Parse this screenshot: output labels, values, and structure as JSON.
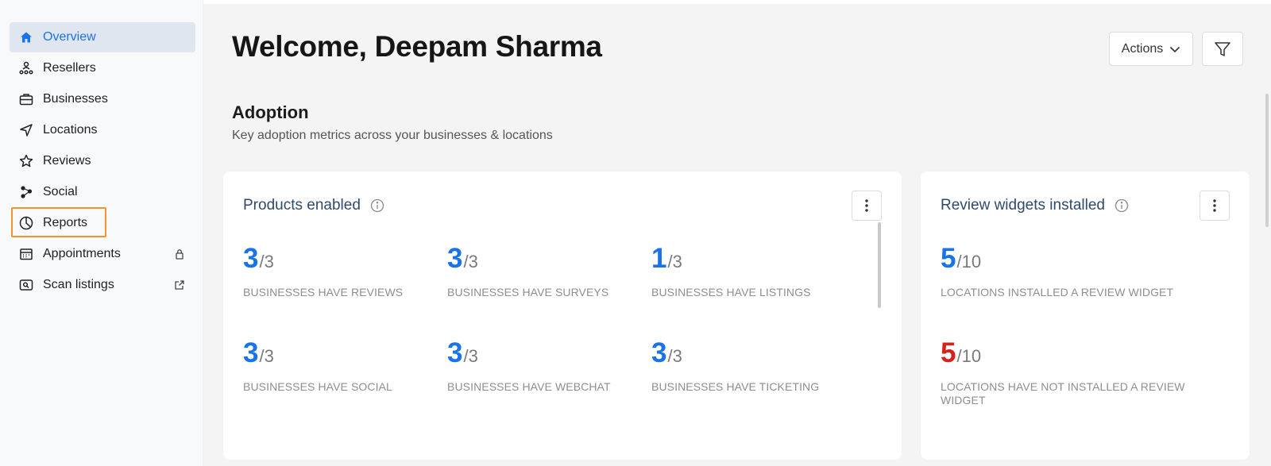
{
  "sidebar": {
    "items": [
      {
        "label": "Overview",
        "icon": "home-icon"
      },
      {
        "label": "Resellers",
        "icon": "resellers-icon"
      },
      {
        "label": "Businesses",
        "icon": "briefcase-icon"
      },
      {
        "label": "Locations",
        "icon": "navigation-arrow-icon"
      },
      {
        "label": "Reviews",
        "icon": "star-icon"
      },
      {
        "label": "Social",
        "icon": "social-nodes-icon"
      },
      {
        "label": "Reports",
        "icon": "pie-chart-icon"
      },
      {
        "label": "Appointments",
        "icon": "calendar-icon"
      },
      {
        "label": "Scan listings",
        "icon": "scan-icon"
      }
    ]
  },
  "header": {
    "title": "Welcome, Deepam Sharma",
    "actions_label": "Actions"
  },
  "adoption": {
    "title": "Adoption",
    "subtitle": "Key adoption metrics across your businesses & locations"
  },
  "products_card": {
    "title": "Products enabled",
    "metrics": [
      {
        "value": "3",
        "total": "/3",
        "caption": "BUSINESSES HAVE REVIEWS"
      },
      {
        "value": "3",
        "total": "/3",
        "caption": "BUSINESSES HAVE SURVEYS"
      },
      {
        "value": "1",
        "total": "/3",
        "caption": "BUSINESSES HAVE LISTINGS"
      },
      {
        "value": "3",
        "total": "/3",
        "caption": "BUSINESSES HAVE SOCIAL"
      },
      {
        "value": "3",
        "total": "/3",
        "caption": "BUSINESSES HAVE WEBCHAT"
      },
      {
        "value": "3",
        "total": "/3",
        "caption": "BUSINESSES HAVE TICKETING"
      }
    ]
  },
  "widgets_card": {
    "title": "Review widgets installed",
    "metrics": [
      {
        "value": "5",
        "total": "/10",
        "caption": "LOCATIONS INSTALLED A REVIEW WIDGET"
      },
      {
        "value": "5",
        "total": "/10",
        "caption": "LOCATIONS HAVE NOT INSTALLED A REVIEW WIDGET"
      }
    ]
  },
  "colors": {
    "accent": "#1a73e8",
    "danger": "#d8211b",
    "highlight": "#f0962e"
  }
}
